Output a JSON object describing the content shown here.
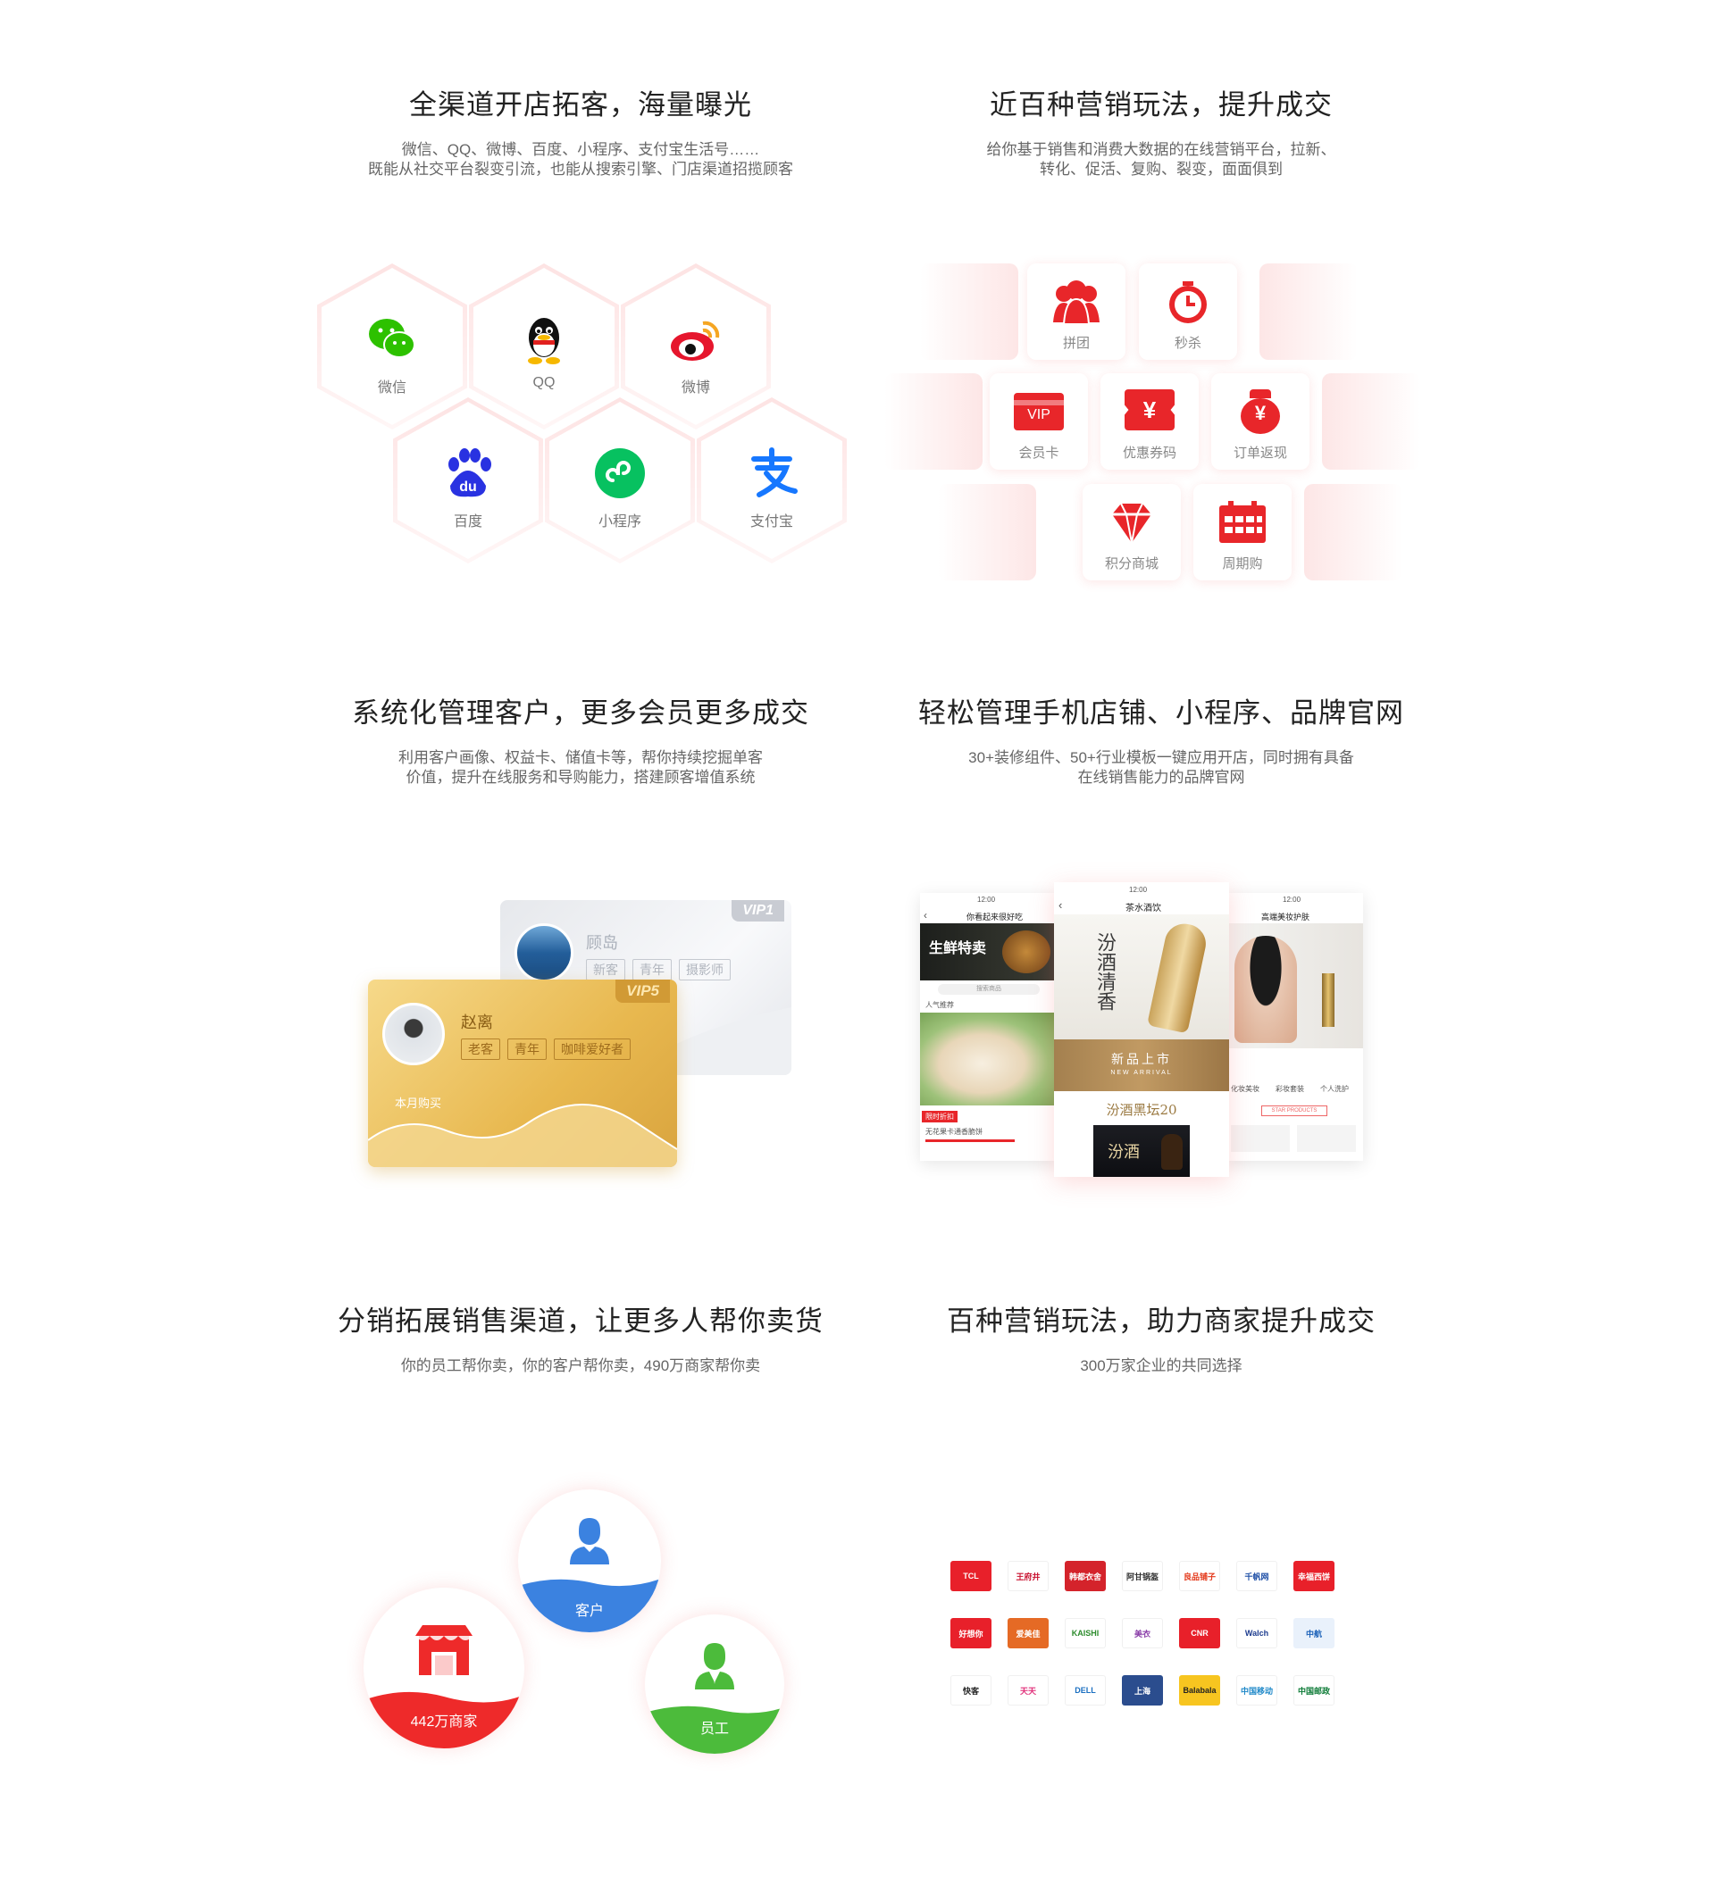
{
  "sections": {
    "s1": {
      "title": "全渠道开店拓客，海量曝光",
      "desc1": "微信、QQ、微博、百度、小程序、支付宝生活号……",
      "desc2": "既能从社交平台裂变引流，也能从搜索引擎、门店渠道招揽顾客"
    },
    "s2": {
      "title": "近百种营销玩法，提升成交",
      "desc1": "给你基于销售和消费大数据的在线营销平台，拉新、",
      "desc2": "转化、促活、复购、裂变，面面俱到"
    },
    "s3": {
      "title": "系统化管理客户，更多会员更多成交",
      "desc1": "利用客户画像、权益卡、储值卡等，帮你持续挖掘单客",
      "desc2": "价值，提升在线服务和导购能力，搭建顾客增值系统"
    },
    "s4": {
      "title": "轻松管理手机店铺、小程序、品牌官网",
      "desc1": "30+装修组件、50+行业模板一键应用开店，同时拥有具备",
      "desc2": "在线销售能力的品牌官网"
    },
    "s5": {
      "title": "分销拓展销售渠道，让更多人帮你卖货",
      "desc1": "你的员工帮你卖，你的客户帮你卖，490万商家帮你卖"
    },
    "s6": {
      "title": "百种营销玩法，助力商家提升成交",
      "desc1": "300万家企业的共同选择"
    }
  },
  "channels": [
    {
      "label": "微信",
      "icon": "wechat-icon"
    },
    {
      "label": "QQ",
      "icon": "qq-icon"
    },
    {
      "label": "微博",
      "icon": "weibo-icon"
    },
    {
      "label": "百度",
      "icon": "baidu-icon"
    },
    {
      "label": "小程序",
      "icon": "miniprogram-icon"
    },
    {
      "label": "支付宝",
      "icon": "alipay-icon"
    }
  ],
  "marketing": [
    {
      "label": "拼团",
      "icon": "group-buy-icon"
    },
    {
      "label": "秒杀",
      "icon": "flash-sale-icon"
    },
    {
      "label": "会员卡",
      "icon": "vip-card-icon",
      "badge": "VIP"
    },
    {
      "label": "优惠券码",
      "icon": "coupon-icon",
      "badge": "¥"
    },
    {
      "label": "订单返现",
      "icon": "cashback-icon",
      "badge": "¥"
    },
    {
      "label": "积分商城",
      "icon": "points-mall-icon"
    },
    {
      "label": "周期购",
      "icon": "periodic-buy-icon"
    }
  ],
  "vip_cards": {
    "back": {
      "name": "顾岛",
      "level": "VIP1",
      "tags": [
        "新客",
        "青年",
        "摄影师"
      ]
    },
    "front": {
      "name": "赵离",
      "level": "VIP5",
      "tags": [
        "老客",
        "青年",
        "咖啡爱好者"
      ],
      "caption": "本月购买"
    }
  },
  "phones": {
    "left": {
      "status_time": "12:00",
      "nav_title": "你看起来很好吃",
      "banner": "生鲜特卖",
      "search": "搜索商品",
      "section": "人气推荐",
      "promo": "限时折扣",
      "item": "无花果卡通香脆饼"
    },
    "center": {
      "status_time": "12:00",
      "nav_title": "茶水酒饮",
      "hero_text": "汾酒清香",
      "band": "新品上市",
      "band_en": "NEW ARRIVAL",
      "product": "汾酒黑坛20",
      "label": "汾酒"
    },
    "right": {
      "status_time": "12:00",
      "nav_title": "高端美妆护肤",
      "btn": "STAR PRODUCTS",
      "nav1": "化妆美妆",
      "nav2": "彩妆套装",
      "nav3": "个人洗护"
    }
  },
  "distribution": [
    {
      "label": "442万商家",
      "icon": "store-icon",
      "color": "#ee2a2a"
    },
    {
      "label": "客户",
      "icon": "customer-icon",
      "color": "#3b82e0"
    },
    {
      "label": "员工",
      "icon": "employee-icon",
      "color": "#4cbb3b"
    }
  ],
  "brands": [
    {
      "name": "TCL",
      "fg": "#fff",
      "bg": "#e8202a"
    },
    {
      "name": "王府井",
      "fg": "#c8102e",
      "bg": "#fff"
    },
    {
      "name": "韩都衣舍",
      "fg": "#fff",
      "bg": "#d4232b"
    },
    {
      "name": "阿甘锅盔",
      "fg": "#333",
      "bg": "#fff"
    },
    {
      "name": "良品铺子",
      "fg": "#e4391b",
      "bg": "#fff"
    },
    {
      "name": "千帆网",
      "fg": "#1d4ea6",
      "bg": "#fff"
    },
    {
      "name": "幸福西饼",
      "fg": "#fff",
      "bg": "#e8202a"
    },
    {
      "name": "好想你",
      "fg": "#fff",
      "bg": "#e8202a"
    },
    {
      "name": "爱美佳",
      "fg": "#fff",
      "bg": "#e56a25"
    },
    {
      "name": "KAISHI",
      "fg": "#2c8b2c",
      "bg": "#fff"
    },
    {
      "name": "美衣",
      "fg": "#8a3ea8",
      "bg": "#fff"
    },
    {
      "name": "CNR",
      "fg": "#fff",
      "bg": "#e8202a"
    },
    {
      "name": "Walch",
      "fg": "#1d3c8f",
      "bg": "#fff"
    },
    {
      "name": "中航",
      "fg": "#1b61b8",
      "bg": "#e9f1fb"
    },
    {
      "name": "快客",
      "fg": "#222",
      "bg": "#fff"
    },
    {
      "name": "天天",
      "fg": "#e0307a",
      "bg": "#fff"
    },
    {
      "name": "DELL",
      "fg": "#1a6fc0",
      "bg": "#fff"
    },
    {
      "name": "上海",
      "fg": "#fff",
      "bg": "#2b4d8e"
    },
    {
      "name": "Balabala",
      "fg": "#222",
      "bg": "#f7c520"
    },
    {
      "name": "中国移动",
      "fg": "#1e88c8",
      "bg": "#fff"
    },
    {
      "name": "中国邮政",
      "fg": "#0b7a35",
      "bg": "#fff"
    }
  ]
}
